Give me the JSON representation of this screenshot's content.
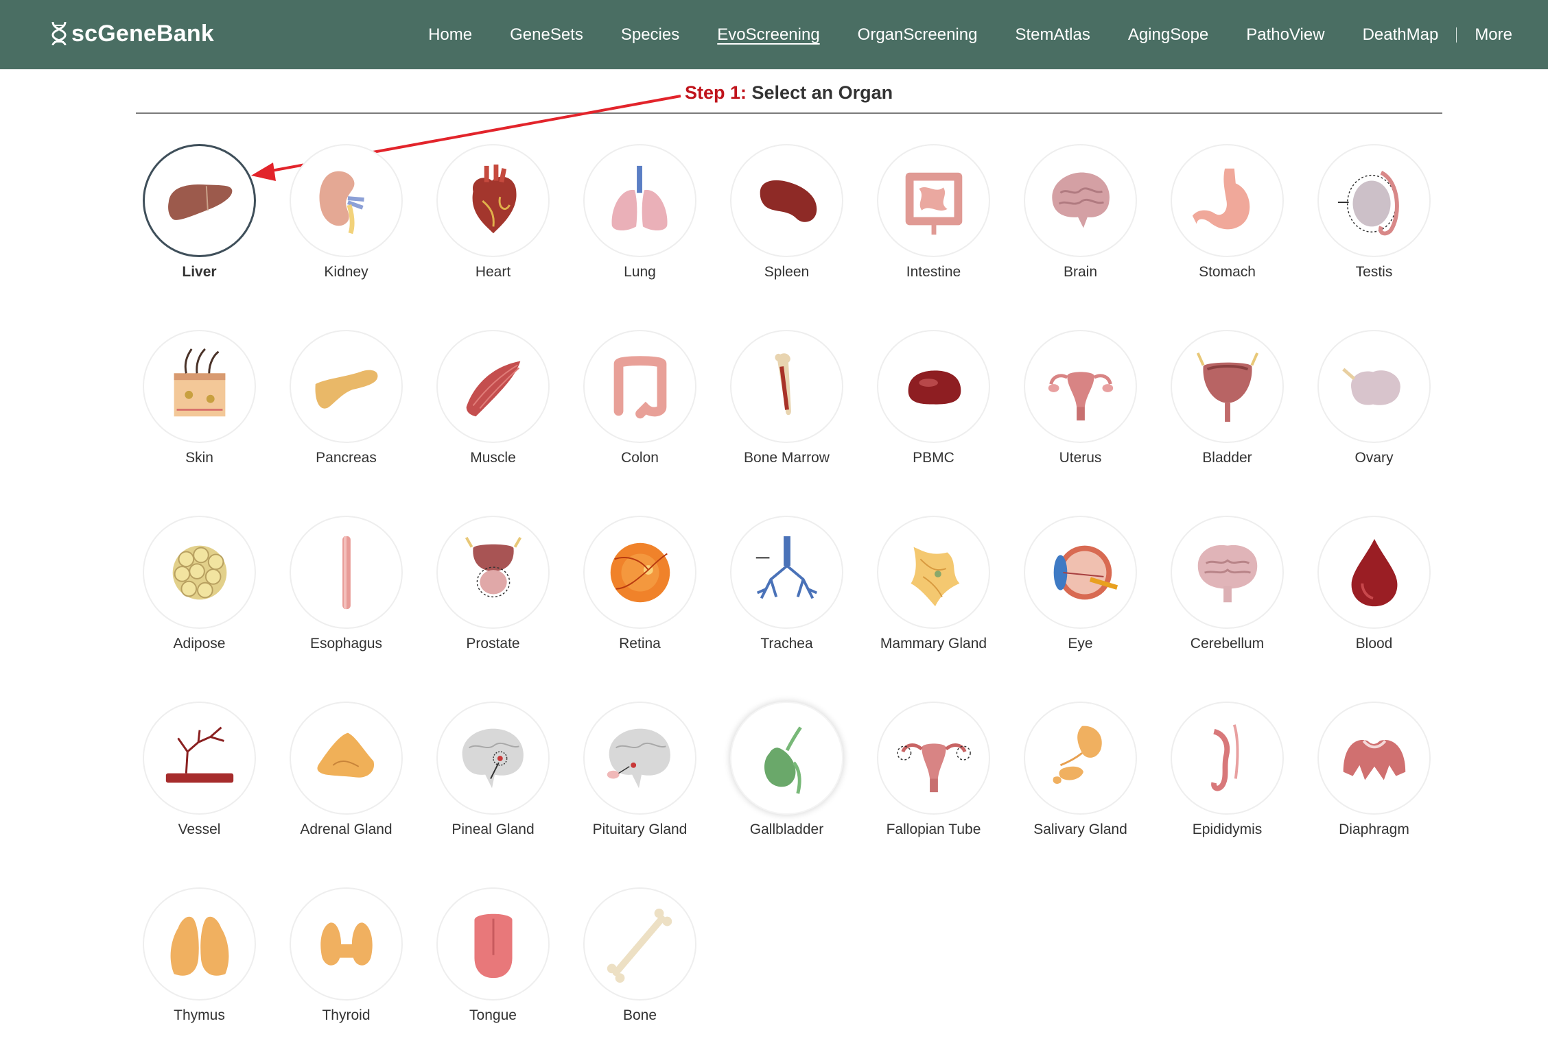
{
  "app": {
    "brand": "scGeneBank"
  },
  "nav": {
    "items": [
      "Home",
      "GeneSets",
      "Species",
      "EvoScreening",
      "OrganScreening",
      "StemAtlas",
      "AgingSope",
      "PathoView",
      "DeathMap"
    ],
    "active": "EvoScreening",
    "more": "More"
  },
  "step": {
    "prefix": "Step 1:",
    "text": " Select an Organ"
  },
  "colors": {
    "header_bg": "#4a6e63",
    "step_red": "#c0141c",
    "arrow_red": "#e2242b"
  },
  "organs": [
    {
      "label": "Liver",
      "icon": "liver-icon",
      "selected": true
    },
    {
      "label": "Kidney",
      "icon": "kidney-icon"
    },
    {
      "label": "Heart",
      "icon": "heart-icon"
    },
    {
      "label": "Lung",
      "icon": "lung-icon"
    },
    {
      "label": "Spleen",
      "icon": "spleen-icon"
    },
    {
      "label": "Intestine",
      "icon": "intestine-icon"
    },
    {
      "label": "Brain",
      "icon": "brain-icon"
    },
    {
      "label": "Stomach",
      "icon": "stomach-icon"
    },
    {
      "label": "Testis",
      "icon": "testis-icon"
    },
    {
      "label": "Skin",
      "icon": "skin-icon"
    },
    {
      "label": "Pancreas",
      "icon": "pancreas-icon"
    },
    {
      "label": "Muscle",
      "icon": "muscle-icon"
    },
    {
      "label": "Colon",
      "icon": "colon-icon"
    },
    {
      "label": "Bone Marrow",
      "icon": "bone-marrow-icon"
    },
    {
      "label": "PBMC",
      "icon": "pbmc-icon"
    },
    {
      "label": "Uterus",
      "icon": "uterus-icon"
    },
    {
      "label": "Bladder",
      "icon": "bladder-icon"
    },
    {
      "label": "Ovary",
      "icon": "ovary-icon"
    },
    {
      "label": "Adipose",
      "icon": "adipose-icon"
    },
    {
      "label": "Esophagus",
      "icon": "esophagus-icon"
    },
    {
      "label": "Prostate",
      "icon": "prostate-icon"
    },
    {
      "label": "Retina",
      "icon": "retina-icon"
    },
    {
      "label": "Trachea",
      "icon": "trachea-icon"
    },
    {
      "label": "Mammary Gland",
      "icon": "mammary-gland-icon"
    },
    {
      "label": "Eye",
      "icon": "eye-icon"
    },
    {
      "label": "Cerebellum",
      "icon": "cerebellum-icon"
    },
    {
      "label": "Blood",
      "icon": "blood-drop-icon"
    },
    {
      "label": "Vessel",
      "icon": "vessel-icon"
    },
    {
      "label": "Adrenal Gland",
      "icon": "adrenal-gland-icon"
    },
    {
      "label": "Pineal Gland",
      "icon": "pineal-gland-icon"
    },
    {
      "label": "Pituitary Gland",
      "icon": "pituitary-gland-icon"
    },
    {
      "label": "Gallbladder",
      "icon": "gallbladder-icon",
      "raised": true
    },
    {
      "label": "Fallopian Tube",
      "icon": "fallopian-tube-icon"
    },
    {
      "label": "Salivary Gland",
      "icon": "salivary-gland-icon"
    },
    {
      "label": "Epididymis",
      "icon": "epididymis-icon"
    },
    {
      "label": "Diaphragm",
      "icon": "diaphragm-icon"
    },
    {
      "label": "Thymus",
      "icon": "thymus-icon"
    },
    {
      "label": "Thyroid",
      "icon": "thyroid-icon"
    },
    {
      "label": "Tongue",
      "icon": "tongue-icon"
    },
    {
      "label": "Bone",
      "icon": "bone-icon"
    }
  ]
}
